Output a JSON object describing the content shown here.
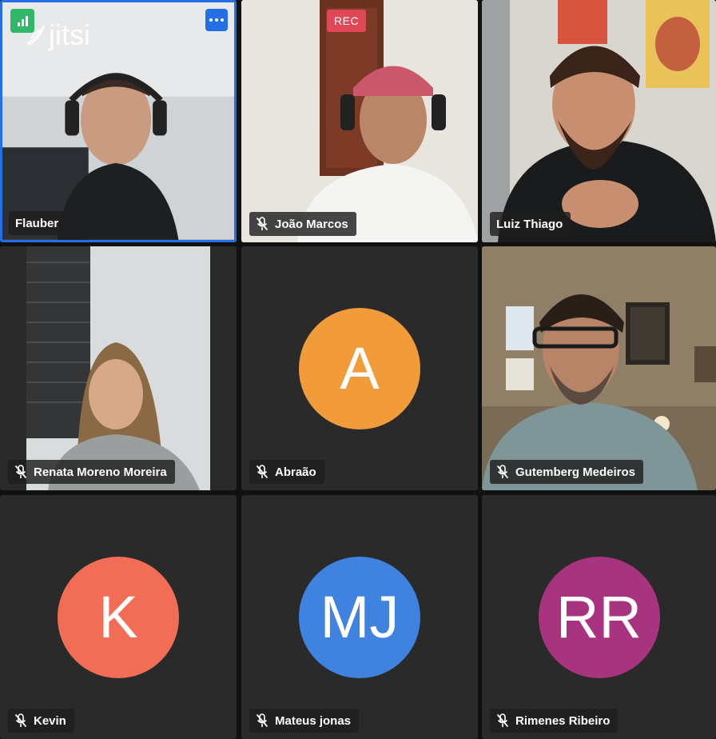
{
  "app": {
    "logo_text": "jitsi",
    "recording_label": "REC"
  },
  "colors": {
    "active_border": "#246fe5",
    "signal_good": "#31b76a",
    "rec": "#e04757"
  },
  "participants": [
    {
      "name": "Flauber",
      "muted": false,
      "video": true,
      "active": true
    },
    {
      "name": "João Marcos",
      "muted": true,
      "video": true
    },
    {
      "name": "Luiz Thiago",
      "muted": false,
      "video": true
    },
    {
      "name": "Renata Moreno Moreira",
      "muted": true,
      "video": true
    },
    {
      "name": "Abraão",
      "muted": true,
      "video": false,
      "initials": "A",
      "avatar_color": "#f29b3a"
    },
    {
      "name": "Gutemberg Medeiros",
      "muted": true,
      "video": true
    },
    {
      "name": "Kevin",
      "muted": true,
      "video": false,
      "initials": "K",
      "avatar_color": "#f26d55"
    },
    {
      "name": "Mateus jonas",
      "muted": true,
      "video": false,
      "initials": "MJ",
      "avatar_color": "#3f82e0"
    },
    {
      "name": "Rimenes Ribeiro",
      "muted": true,
      "video": false,
      "initials": "RR",
      "avatar_color": "#a8337e"
    }
  ]
}
